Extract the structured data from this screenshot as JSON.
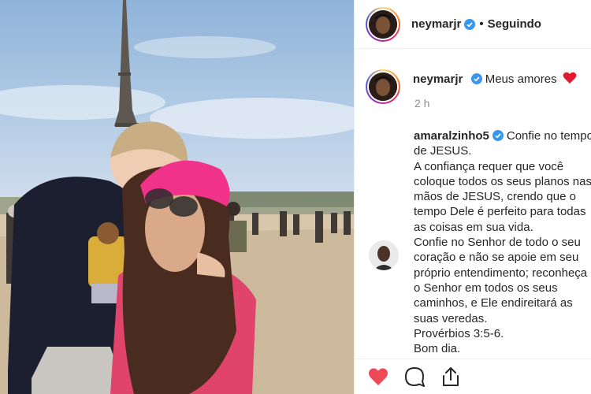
{
  "header": {
    "username": "neymarjr",
    "separator": "•",
    "follow_status": "Seguindo",
    "verified_color": "#3897f0"
  },
  "caption": {
    "username": "neymarjr",
    "text": "Meus amores",
    "emoji": "red-heart",
    "time": "2 h"
  },
  "comment": {
    "username": "amaralzinho5",
    "text": "Confie no tempo de JESUS.\nA confiança requer que você coloque todos os seus planos nas mãos de JESUS, crendo que o tempo Dele é perfeito para todas as coisas em sua vida.\nConfie no Senhor de todo o seu coração e não se apoie em seu próprio entendimento; reconheça o Senhor em todos os seus caminhos, e Ele endireitará as suas veredas.\nProvérbios 3:5-6.\nBom dia."
  },
  "actions": {
    "like_icon": "heart-filled",
    "like_color": "#ed4956",
    "comment_icon": "speech-bubble",
    "share_icon": "share-upload"
  }
}
